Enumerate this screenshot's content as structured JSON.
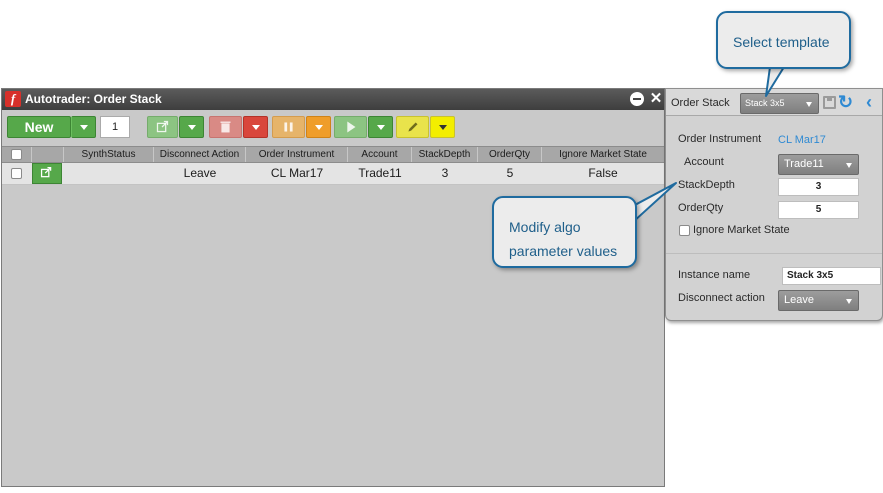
{
  "window": {
    "title": "Autotrader: Order Stack",
    "app_icon": "f"
  },
  "toolbar": {
    "new_label": "New",
    "quantity": "1",
    "icons": [
      "launch-icon",
      "trash-icon",
      "pause-icon",
      "play-icon",
      "pencil-icon"
    ]
  },
  "grid": {
    "columns": [
      "SynthStatus",
      "Disconnect Action",
      "Order Instrument",
      "Account",
      "StackDepth",
      "OrderQty",
      "Ignore Market State"
    ],
    "rows": [
      {
        "synth_status": "",
        "disconnect_action": "Leave",
        "order_instrument": "CL Mar17",
        "account": "Trade11",
        "stack_depth": "3",
        "order_qty": "5",
        "ignore_market_state": "False"
      }
    ]
  },
  "panel": {
    "order_stack_label": "Order Stack",
    "template_value": "Stack 3x5",
    "order_instrument_label": "Order Instrument",
    "order_instrument_value": "CL Mar17",
    "account_label": "Account",
    "account_value": "Trade11",
    "stack_depth_label": "StackDepth",
    "stack_depth_value": "3",
    "order_qty_label": "OrderQty",
    "order_qty_value": "5",
    "ignore_market_state_label": "Ignore Market State",
    "instance_name_label": "Instance name",
    "instance_name_value": "Stack 3x5",
    "disconnect_action_label": "Disconnect action",
    "disconnect_action_value": "Leave"
  },
  "callouts": {
    "select_template": "Select template",
    "modify_line1": "Modify algo",
    "modify_line2": "parameter values"
  },
  "colors": {
    "accent_blue": "#2f8ad3",
    "callout_border": "#1f6b9f",
    "green": "#56a84a",
    "red": "#d9463c",
    "orange": "#ef9d2a",
    "yellow": "#f3ee00"
  }
}
